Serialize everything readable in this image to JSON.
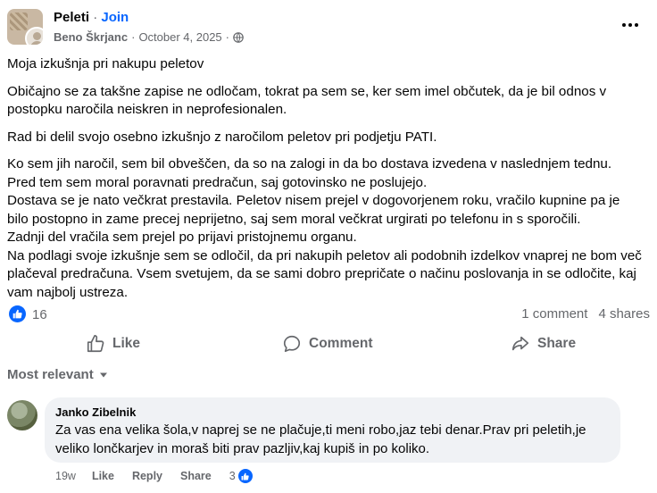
{
  "post": {
    "group_name": "Peleti",
    "separator": "·",
    "join_label": "Join",
    "author": "Beno Škrjanc",
    "date": "October 4, 2025",
    "privacy_icon": "globe-icon",
    "more_icon": "more-options-icon",
    "paragraphs": [
      "Moja izkušnja pri nakupu peletov",
      "Običajno se za takšne zapise ne odločam, tokrat pa sem se, ker sem imel občutek, da je bil odnos v postopku naročila neiskren in neprofesionalen.",
      "Rad bi delil svojo osebno izkušnjo z naročilom peletov pri podjetju PATI."
    ],
    "body_lines": [
      "Ko sem jih naročil, sem bil obveščen, da so na zalogi in da bo dostava izvedena v naslednjem tednu.",
      "Pred tem sem moral poravnati predračun, saj gotovinsko ne poslujejo.",
      "Dostava se je nato večkrat prestavila. Peletov nisem prejel v dogovorjenem roku, vračilo kupnine pa je bilo postopno in zame precej neprijetno, saj sem moral večkrat urgirati po telefonu in s sporočili.",
      "Zadnji del vračila sem prejel po prijavi pristojnemu organu.",
      "Na podlagi svoje izkušnje sem se odločil, da pri nakupih peletov ali podobnih izdelkov vnaprej ne bom več plačeval predračuna. Vsem svetujem, da se sami dobro prepričate o načinu poslovanja in se odločite, kaj vam najbolj ustreza."
    ]
  },
  "stats": {
    "reaction_count": "16",
    "comments": "1 comment",
    "shares": "4 shares"
  },
  "actions": {
    "like": "Like",
    "comment": "Comment",
    "share": "Share"
  },
  "sort": {
    "label": "Most relevant"
  },
  "comment": {
    "author": "Janko Zibelnik",
    "text": "Za vas ena velika šola,v naprej se ne plačuje,ti meni robo,jaz tebi denar.Prav pri peletih,je veliko lončkarjev in moraš biti prav pazljiv,kaj kupiš in po koliko.",
    "time": "19w",
    "like": "Like",
    "reply": "Reply",
    "share": "Share",
    "reactions": "3"
  },
  "colors": {
    "accent": "#0866ff",
    "secondary_text": "#65676b",
    "bubble": "#f0f2f5"
  }
}
